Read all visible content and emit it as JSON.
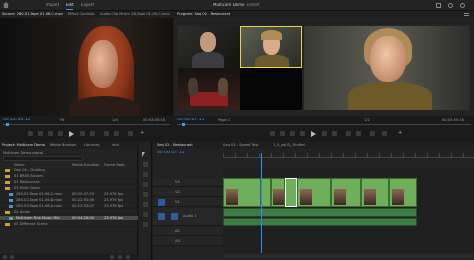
{
  "menu": {
    "items": [
      "Import",
      "Edit",
      "Export"
    ],
    "title": "Multicam Demo",
    "title_suffix": "- Edited"
  },
  "source_monitor": {
    "tabs": [
      "Source: 280-01-Tape 01-06.C.mov",
      "Effect Controls",
      "Audio Clip Mixer: 26-Tape 01-06-C-mov"
    ],
    "timecode_in": "00:22:46:12",
    "zoom": "Fit",
    "fraction": "1/4",
    "duration": "00:03:05:16"
  },
  "program_monitor": {
    "tab": "Program: Seq 02 - Restaurant",
    "timecode": "00:00:07:11",
    "page": "Page 1",
    "fraction": "1/2",
    "duration": "00:03:55:16"
  },
  "project": {
    "tabs": [
      "Project: Multicam Demo",
      "Media Browser",
      "Libraries",
      "Info"
    ],
    "path": "Multicam Demo.prproj",
    "columns": [
      "Name",
      "Media Duration",
      "Frame Rate"
    ],
    "items": [
      {
        "name": "Day 04 - Grading",
        "duration": "",
        "rate": ""
      },
      {
        "name": "01 BREE Rushes",
        "duration": "",
        "rate": ""
      },
      {
        "name": "02 Restaurant",
        "duration": "",
        "rate": ""
      },
      {
        "name": "03 Multi Video",
        "duration": "",
        "rate": ""
      },
      {
        "name": "280-01-Tape 01-06-C.mov",
        "duration": "00:22:47:20",
        "rate": "23.976 fps"
      },
      {
        "name": "280-02-Tape 01-06-B.mov",
        "duration": "00:22:50:06",
        "rate": "23.976 fps"
      },
      {
        "name": "280-03-Tape 01-06-A.mov",
        "duration": "00:22:53:07",
        "rate": "23.976 fps"
      },
      {
        "name": "04 Audio",
        "duration": "",
        "rate": ""
      },
      {
        "name": "Multicam Fine Music Mix",
        "duration": "00:04:26:04",
        "rate": "23.976 fps"
      },
      {
        "name": "05 Different Scene",
        "duration": "",
        "rate": ""
      }
    ]
  },
  "timeline": {
    "tabs": [
      "Seq 02 - Restaurant",
      "Seq 03 - Speed Test",
      "1_4_sq03_-ProRes"
    ],
    "timecode": "00:00:07:11",
    "video_tracks": [
      "V3",
      "V2",
      "V1"
    ],
    "audio_tracks": [
      "A1",
      "A2",
      "A3"
    ],
    "track_label": "Audio 1"
  },
  "colors": {
    "accent_blue": "#4a90ff",
    "clip_green": "#6fae5b",
    "playhead_blue": "#2d8cff"
  }
}
